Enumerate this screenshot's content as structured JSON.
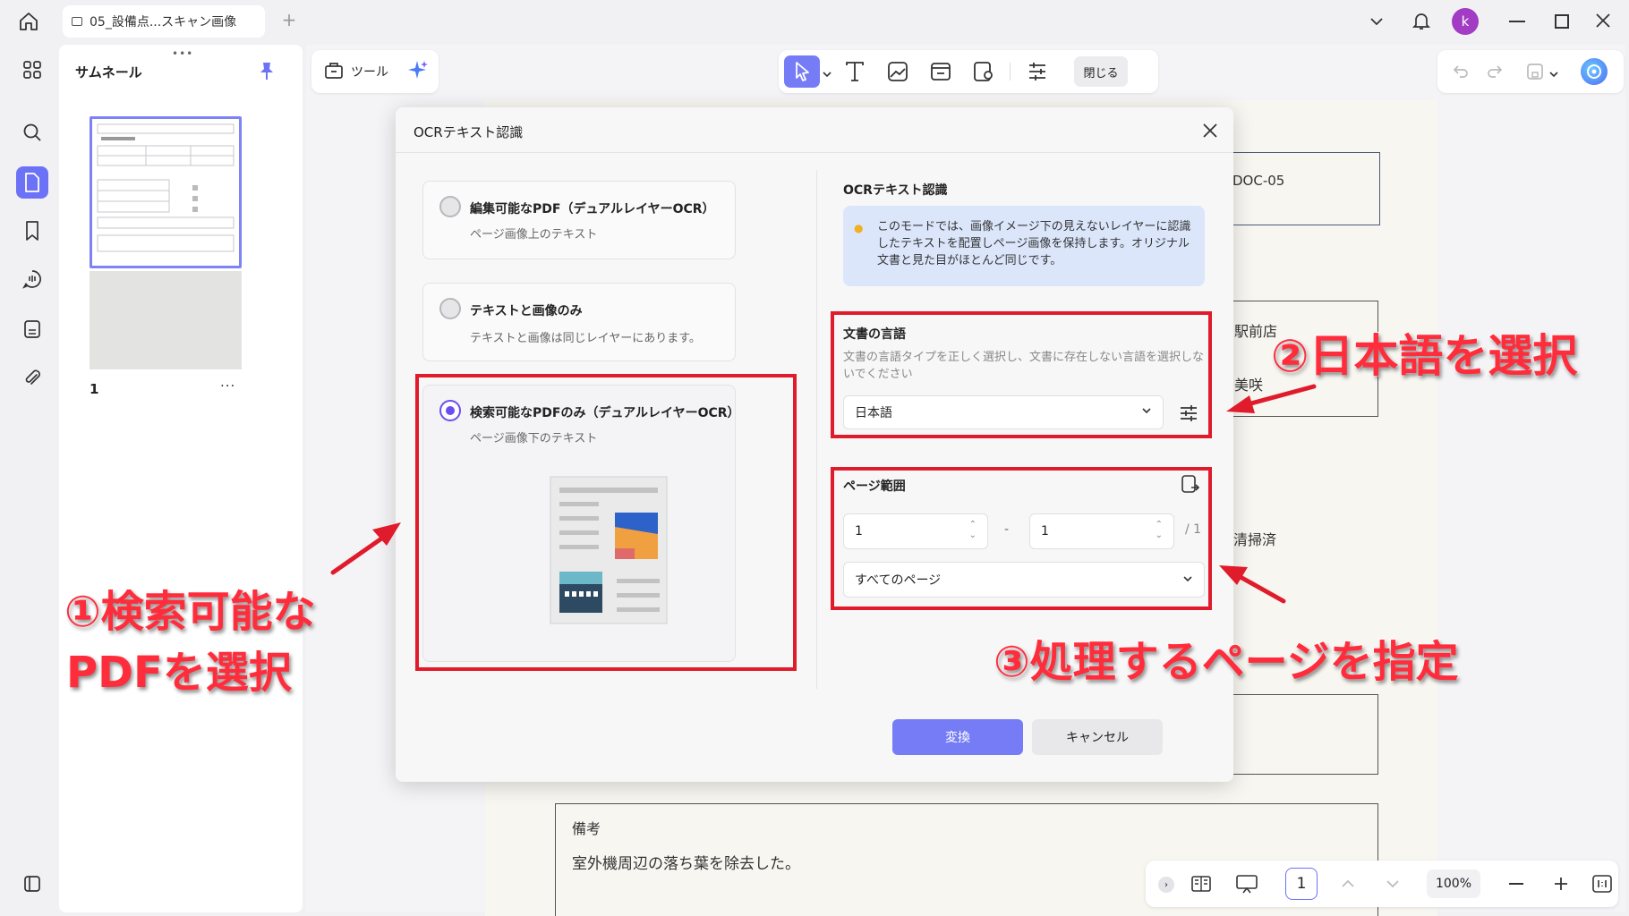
{
  "tab": {
    "title": "05_設備点...スキャン画像"
  },
  "user": {
    "avatar_initial": "k"
  },
  "thumbnail_panel": {
    "title": "サムネール",
    "page_number": "1",
    "more": "..."
  },
  "toolbar": {
    "tools_label": "ツール",
    "close_label": "閉じる"
  },
  "document": {
    "doc_code": "DOC-05",
    "station": "駅前店",
    "person": "美咲",
    "cleaning": "清掃済",
    "remarks_label": "備考",
    "remarks_text": "室外機周辺の落ち葉を除去した。"
  },
  "dialog": {
    "title": "OCRテキスト認識",
    "options": [
      {
        "title": "編集可能なPDF（デュアルレイヤーOCR）",
        "sub": "ページ画像上のテキスト",
        "selected": false
      },
      {
        "title": "テキストと画像のみ",
        "sub": "テキストと画像は同じレイヤーにあります。",
        "selected": false
      },
      {
        "title": "検索可能なPDFのみ（デュアルレイヤーOCR）",
        "sub": "ページ画像下のテキスト",
        "selected": true
      }
    ],
    "right_title": "OCRテキスト認識",
    "info_text": "このモードでは、画像イメージ下の見えないレイヤーに認識したテキストを配置しページ画像を保持します。オリジナル文書と見た目がほとんど同じです。",
    "language": {
      "title": "文書の言語",
      "description": "文書の言語タイプを正しく選択し、文書に存在しない言語を選択しないでください",
      "value": "日本語"
    },
    "page_range": {
      "title": "ページ範囲",
      "from": "1",
      "separator": "-",
      "to": "1",
      "total": "/ 1",
      "scope": "すべてのページ"
    },
    "convert_label": "変換",
    "cancel_label": "キャンセル"
  },
  "annotations": {
    "step1_line1": "①検索可能な",
    "step1_line2": "PDFを選択",
    "step2": "②日本語を選択",
    "step3": "③処理するページを指定"
  },
  "bottom_bar": {
    "page": "1",
    "zoom": "100%"
  },
  "colors": {
    "accent": "#6b72f6",
    "radio": "#6b4ef0",
    "annotation_red": "#e01b2b"
  }
}
